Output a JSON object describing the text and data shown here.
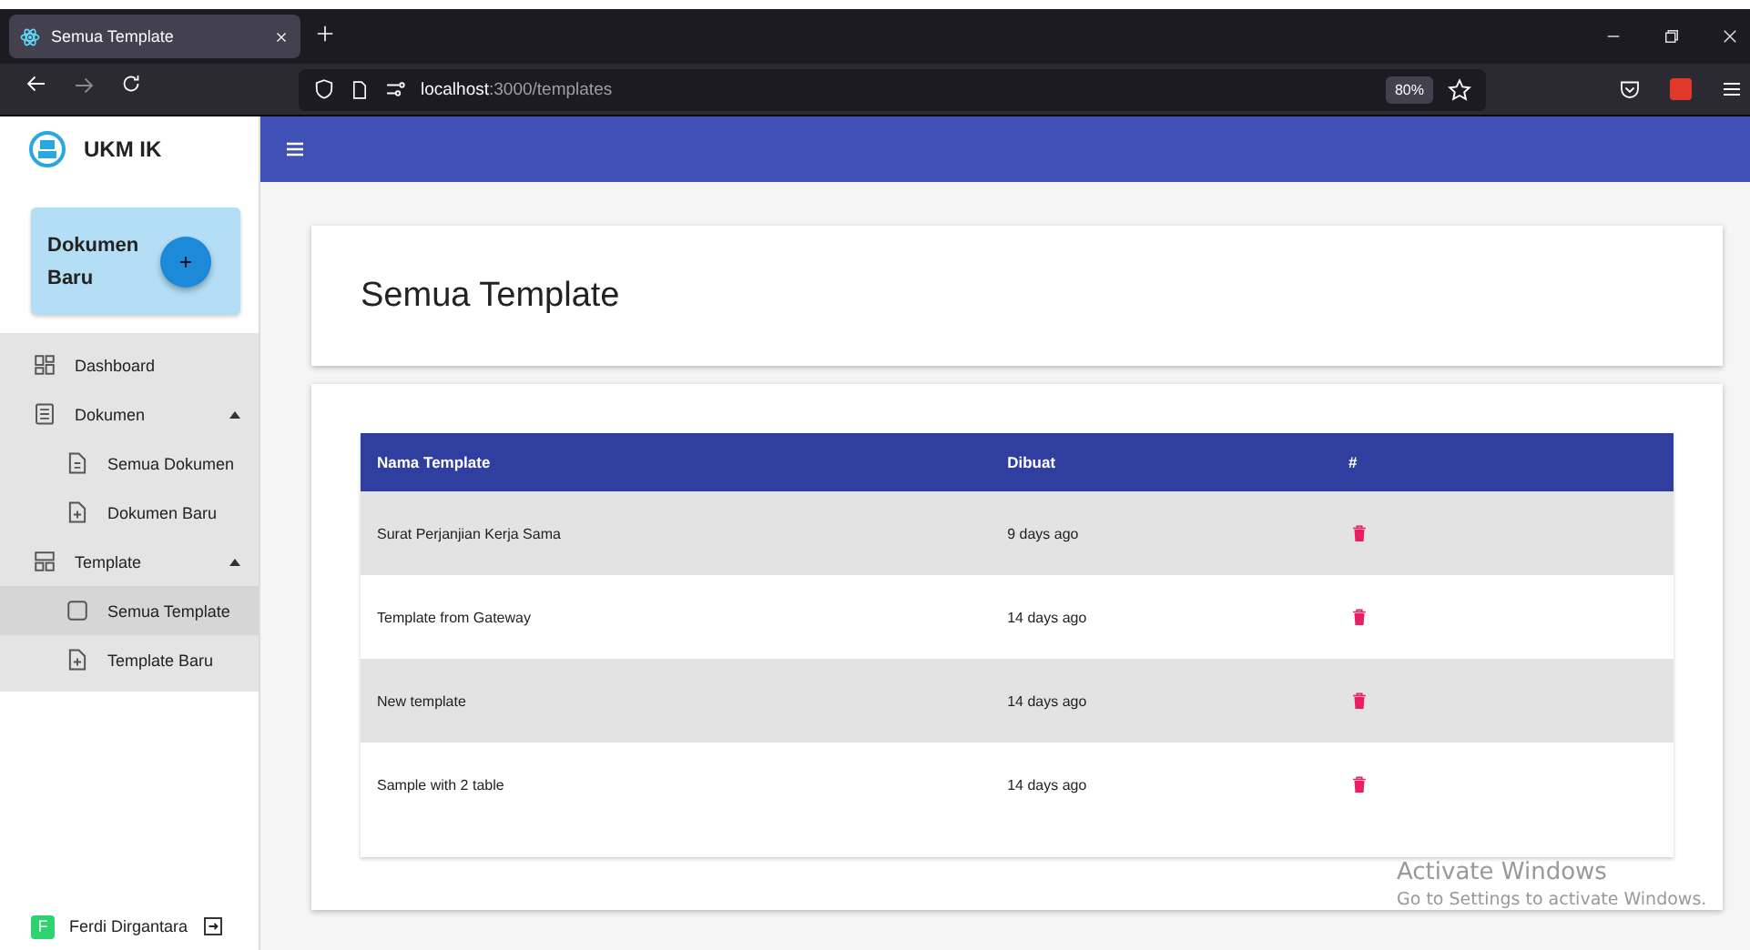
{
  "browser": {
    "tab": {
      "title": "Semua Template"
    },
    "url": {
      "host": "localhost",
      "path": ":3000/templates"
    },
    "zoom": "80%"
  },
  "sidebar": {
    "brand": "UKM IK",
    "new_doc": {
      "label": "Dokumen Baru"
    },
    "items": [
      {
        "label": "Dashboard",
        "kind": "dashboard",
        "selected": false
      },
      {
        "label": "Dokumen",
        "kind": "document",
        "selected": false,
        "expanded": true,
        "children": [
          {
            "label": "Semua Dokumen",
            "kind": "file",
            "selected": false
          },
          {
            "label": "Dokumen Baru",
            "kind": "newfile",
            "selected": false
          }
        ]
      },
      {
        "label": "Template",
        "kind": "template",
        "selected": false,
        "expanded": true,
        "children": [
          {
            "label": "Semua Template",
            "kind": "blank",
            "selected": true
          },
          {
            "label": "Template Baru",
            "kind": "newfile",
            "selected": false
          }
        ]
      }
    ],
    "user": {
      "initial": "F",
      "name": "Ferdi Dirgantara"
    }
  },
  "page": {
    "title": "Semua Template"
  },
  "table": {
    "columns": [
      "Nama Template",
      "Dibuat",
      "#"
    ],
    "rows": [
      {
        "name": "Surat Perjanjian Kerja Sama",
        "created": "9 days ago"
      },
      {
        "name": "Template from Gateway",
        "created": "14 days ago"
      },
      {
        "name": "New template",
        "created": "14 days ago"
      },
      {
        "name": "Sample with 2 table",
        "created": "14 days ago"
      }
    ]
  },
  "os_notice": {
    "title": "Activate Windows",
    "text": "Go to Settings to activate Windows."
  }
}
